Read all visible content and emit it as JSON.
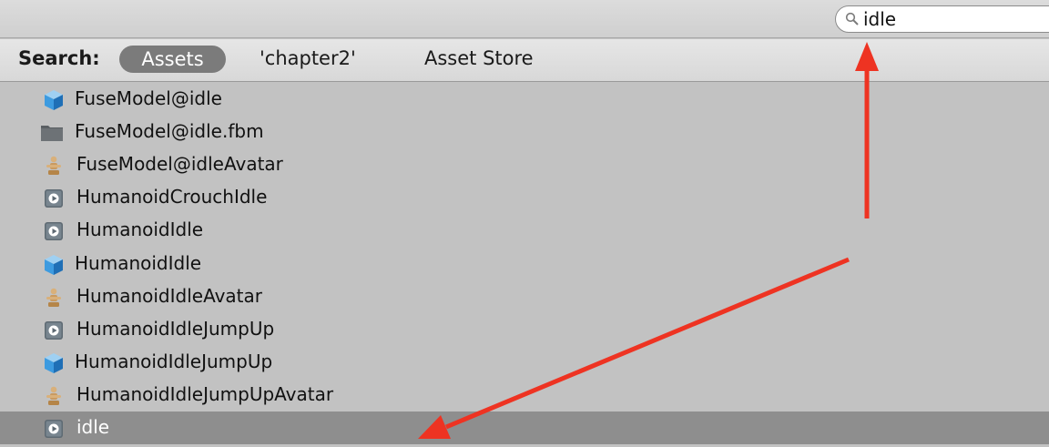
{
  "search": {
    "value": "idle",
    "icon": "magnifier-icon"
  },
  "filter": {
    "label": "Search:",
    "scopes": [
      "Assets",
      "'chapter2'",
      "Asset Store"
    ],
    "active_scope": "Assets"
  },
  "results": [
    {
      "icon": "model-icon",
      "label": "FuseModel@idle"
    },
    {
      "icon": "folder-icon",
      "label": "FuseModel@idle.fbm"
    },
    {
      "icon": "avatar-icon",
      "label": "FuseModel@idleAvatar"
    },
    {
      "icon": "animation-clip-icon",
      "label": "HumanoidCrouchIdle"
    },
    {
      "icon": "animation-clip-icon",
      "label": "HumanoidIdle"
    },
    {
      "icon": "model-icon",
      "label": "HumanoidIdle"
    },
    {
      "icon": "avatar-icon",
      "label": "HumanoidIdleAvatar"
    },
    {
      "icon": "animation-clip-icon",
      "label": "HumanoidIdleJumpUp"
    },
    {
      "icon": "model-icon",
      "label": "HumanoidIdleJumpUp"
    },
    {
      "icon": "avatar-icon",
      "label": "HumanoidIdleJumpUpAvatar"
    },
    {
      "icon": "animation-clip-icon",
      "label": "idle",
      "selected": true
    }
  ],
  "colors": {
    "annotation_arrow": "#ee3322",
    "selected_row": "#8e8e8e",
    "list_background": "#c2c2c2",
    "model_cube": "#3d9be0"
  }
}
